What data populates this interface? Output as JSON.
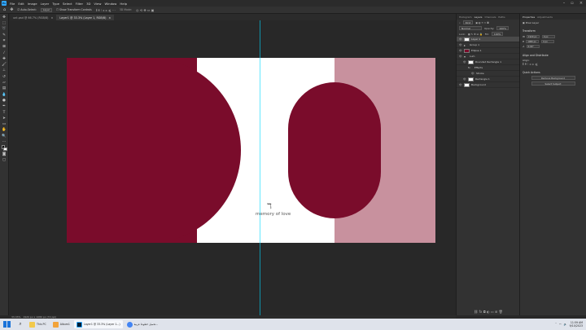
{
  "menubar": {
    "logo": "Ps",
    "items": [
      "File",
      "Edit",
      "Image",
      "Layer",
      "Type",
      "Select",
      "Filter",
      "3D",
      "View",
      "Window",
      "Help"
    ]
  },
  "options_bar": {
    "auto_select": "Auto-Select:",
    "layer_dropdown": "Layer",
    "show_transform": "Show Transform Controls",
    "mode_3d": "3D Mode:"
  },
  "tabs": [
    {
      "label": "unt.psd @ 66.7% (RGB/8)"
    },
    {
      "label": "Layer1 @ 33.3% (Layer 1, RGB/8)"
    }
  ],
  "document": {
    "logo_mark": "ℸ",
    "logo_text": "memory of love",
    "colors": {
      "maroon": "#7a0c2b",
      "pink": "#c8919e",
      "white": "#ffffff",
      "guide": "#00d8ff"
    }
  },
  "status": {
    "zoom": "33.33%",
    "info": "1920 px x 1080 px (72 ppi)"
  },
  "layers_panel": {
    "tabs": [
      "Histogram",
      "Layers",
      "Channels",
      "Paths"
    ],
    "kind": "Kind",
    "blend": "Normal",
    "opacity_label": "Opacity:",
    "opacity": "100%",
    "lock": "Lock:",
    "fill_label": "Fill:",
    "fill": "100%",
    "layers": [
      {
        "name": "Layer 1",
        "type": "pixel",
        "selected": true
      },
      {
        "name": "Group 1",
        "type": "group"
      },
      {
        "name": "Ellipse 1",
        "type": "shape"
      },
      {
        "name": "Lum",
        "type": "group"
      },
      {
        "name": "Rounded Rectangle 1",
        "type": "shape"
      },
      {
        "name": "Effects",
        "type": "fx"
      },
      {
        "name": "Stroke",
        "type": "fx"
      },
      {
        "name": "Rectangle 1",
        "type": "shape"
      },
      {
        "name": "Background",
        "type": "pixel"
      }
    ]
  },
  "properties_panel": {
    "tabs": [
      "Properties",
      "Adjustments"
    ],
    "layer_type": "Pixel Layer",
    "transform": "Transform",
    "w": "1920 px",
    "h": "1080 px",
    "x": "0 px",
    "y": "0 px",
    "angle": "0.00°",
    "align": "Align and Distribute",
    "align_label": "Align:",
    "quick_actions": "Quick Actions",
    "remove_bg": "Remove Background",
    "select_subject": "Select Subject"
  },
  "taskbar": {
    "apps": [
      {
        "label": "This PC",
        "color": "#f2c94c"
      },
      {
        "label": "Album1",
        "color": "#f2a33a"
      },
      {
        "label": "Layer1 @ 33.3% (Layer 1...)",
        "color": "#31a8ff",
        "active": true
      },
      {
        "label": "تحميل خطوط عربية...",
        "color": "#4285f4"
      }
    ],
    "time": "11:59 AM",
    "date": "9/10/2023"
  }
}
